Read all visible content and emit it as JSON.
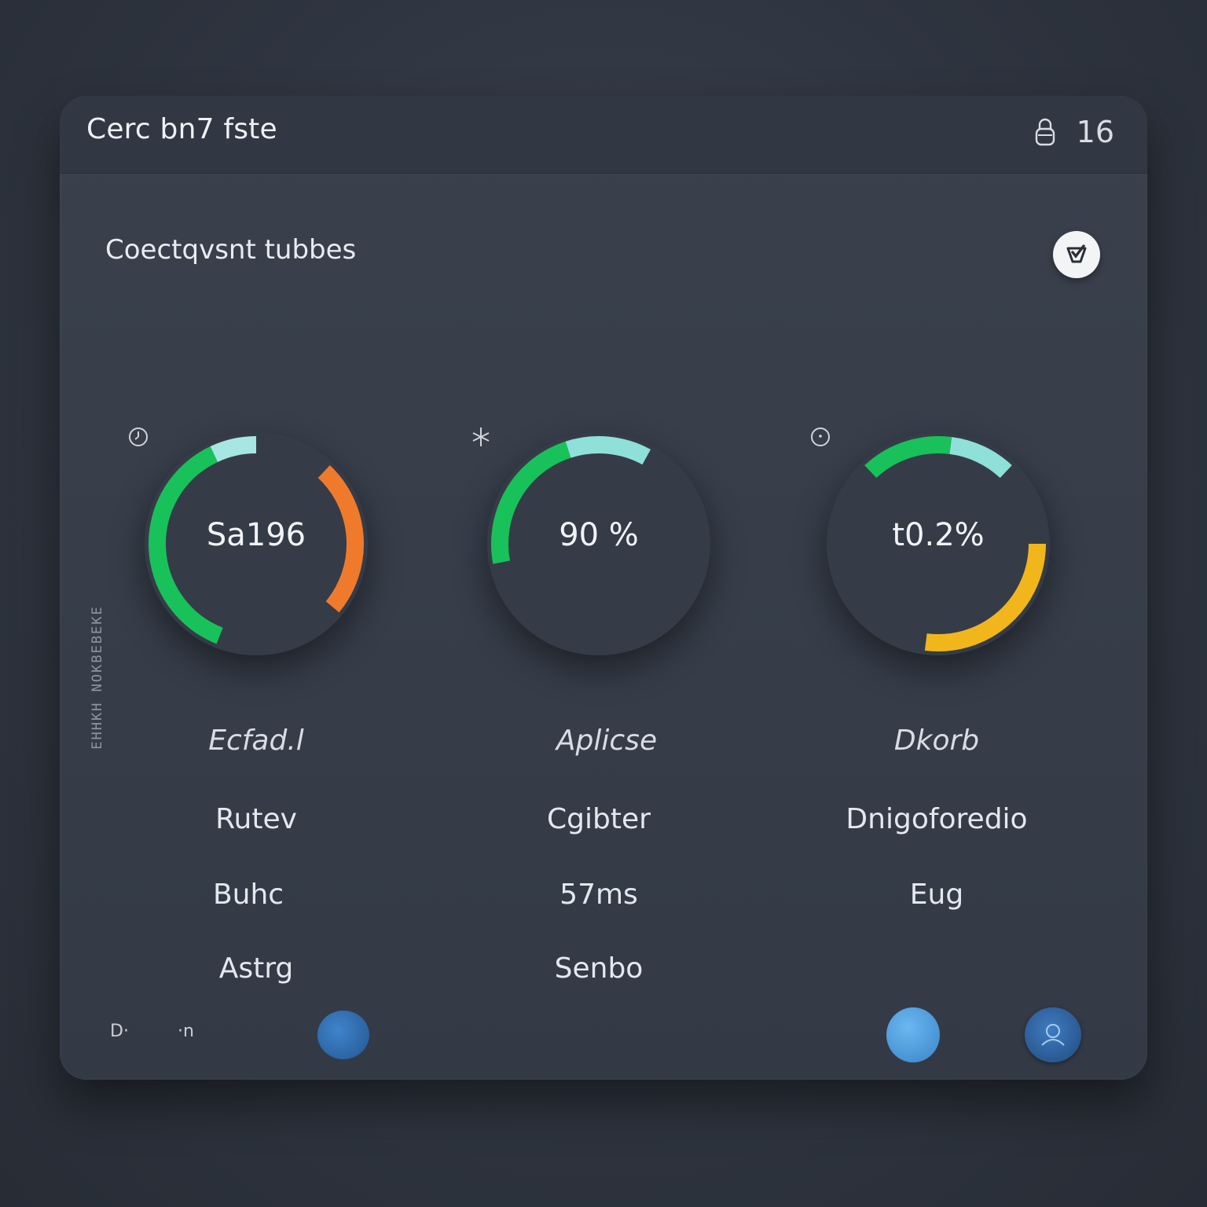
{
  "window": {
    "title": "Cerc bn7 fste",
    "counter": "16",
    "lock_icon": "lock-icon"
  },
  "section": {
    "title": "Coectqvsnt tubbes",
    "action_icon": "check-badge-icon"
  },
  "side_label": "EHHKH NOKBEBEKE",
  "gauges": [
    {
      "value_text": "Sa196",
      "icon": "clock-icon",
      "segments": [
        {
          "color": "#19c15a",
          "start": 0.56,
          "end": 0.93
        },
        {
          "color": "#a7e6e2",
          "start": 0.93,
          "end": 1.0
        },
        {
          "color": "#f07a2c",
          "start": 0.12,
          "end": 0.36
        }
      ]
    },
    {
      "value_text": "90 %",
      "icon": "sparkle-icon",
      "segments": [
        {
          "color": "#19c15a",
          "start": 0.72,
          "end": 0.95
        },
        {
          "color": "#8fe0d8",
          "start": 0.95,
          "end": 1.08
        }
      ]
    },
    {
      "value_text": "t0.2%",
      "icon": "smile-icon",
      "segments": [
        {
          "color": "#19c15a",
          "start": 0.88,
          "end": 1.02
        },
        {
          "color": "#8fe0d8",
          "start": 1.02,
          "end": 1.12
        },
        {
          "color": "#f1b61c",
          "start": 0.25,
          "end": 0.52
        }
      ]
    }
  ],
  "table": {
    "headers": [
      "Ecfad.l",
      "Aplicse",
      "Dkorb"
    ],
    "rows": [
      [
        "Rutev",
        "Cgibter",
        "Dnigoforedio"
      ],
      [
        "Buhc",
        "57ms",
        "Eug"
      ],
      [
        "Astrg",
        "Senbo",
        ""
      ]
    ]
  },
  "footer": {
    "left_a": "D·",
    "left_b": "·n",
    "dots": [
      {
        "name": "status-dot-left",
        "color": "#2f6fb5"
      },
      {
        "name": "status-dot-right",
        "color": "#4a9de0"
      },
      {
        "name": "avatar-dot",
        "color": "#2d5f9c"
      }
    ]
  }
}
